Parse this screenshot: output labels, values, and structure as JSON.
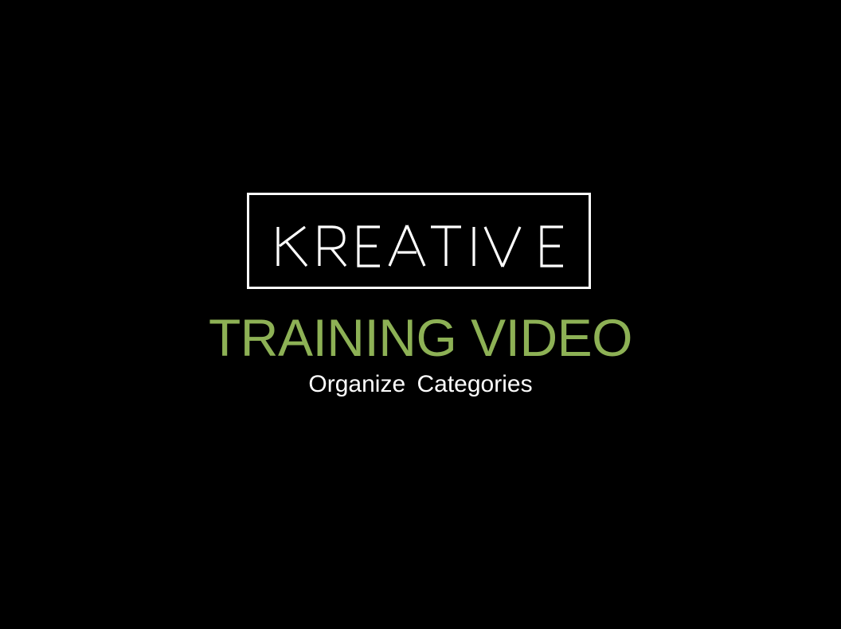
{
  "logo": {
    "text": "KREATIVE",
    "color": "#ffffff"
  },
  "title": {
    "text": "TRAINING VIDEO",
    "color": "#8db155"
  },
  "subtitle": {
    "text": "Organize Categories",
    "color": "#ffffff"
  },
  "background_color": "#000000"
}
